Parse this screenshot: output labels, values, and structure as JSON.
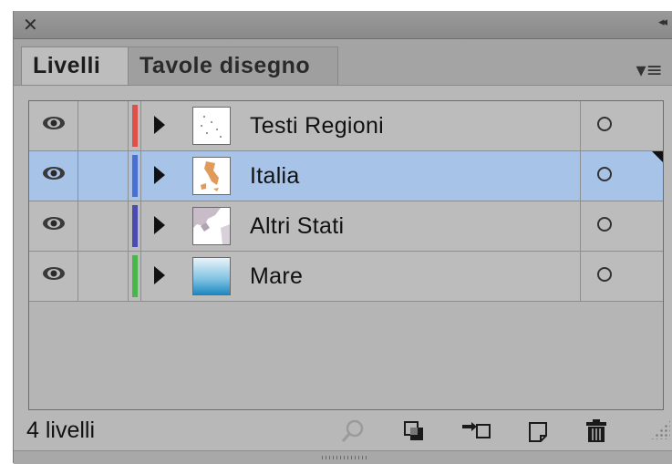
{
  "panel": {
    "close_glyph": "✕",
    "collapse_glyph": "◂◂",
    "menu_glyph": "▾≡",
    "tabs": [
      {
        "label": "Livelli",
        "active": true
      },
      {
        "label": "Tavole disegno",
        "active": false
      }
    ]
  },
  "layers": [
    {
      "name": "Testi Regioni",
      "color": "#e0504a",
      "selected": false,
      "visible": true
    },
    {
      "name": "Italia",
      "color": "#4a6fd0",
      "selected": true,
      "visible": true
    },
    {
      "name": "Altri Stati",
      "color": "#4a4ab0",
      "selected": false,
      "visible": true
    },
    {
      "name": "Mare",
      "color": "#49b649",
      "selected": false,
      "visible": true
    }
  ],
  "footer": {
    "count_label": "4 livelli",
    "icons": [
      "locate-object-icon",
      "make-clipping-mask-icon",
      "create-sublayer-icon",
      "new-layer-icon",
      "delete-icon"
    ]
  },
  "colors": {
    "panel_bg": "#b8b8b8",
    "selection": "#a8c3e8"
  }
}
